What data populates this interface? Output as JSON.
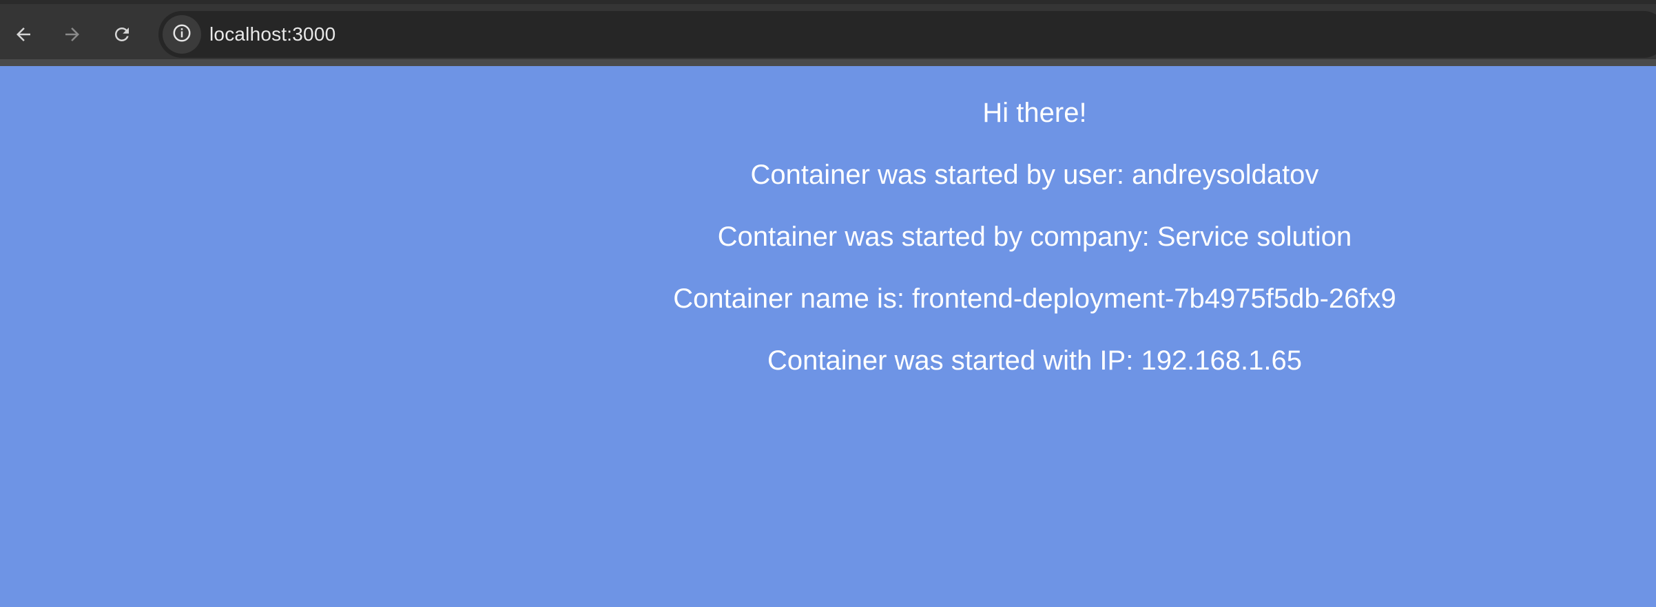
{
  "browser": {
    "address_bar": {
      "url": "localhost:3000",
      "site_info_icon": "info-circle-icon"
    },
    "nav": {
      "back_icon": "arrow-left-icon",
      "forward_icon": "arrow-right-icon",
      "reload_icon": "reload-icon"
    }
  },
  "page": {
    "background_color": "#6e94e5",
    "text_color": "#ffffff",
    "lines": [
      "Hi there!",
      "Container was started by user: andreysoldatov",
      "Container was started by company: Service solution",
      "Container name is: frontend-deployment-7b4975f5db-26fx9",
      "Container was started with IP: 192.168.1.65"
    ]
  }
}
